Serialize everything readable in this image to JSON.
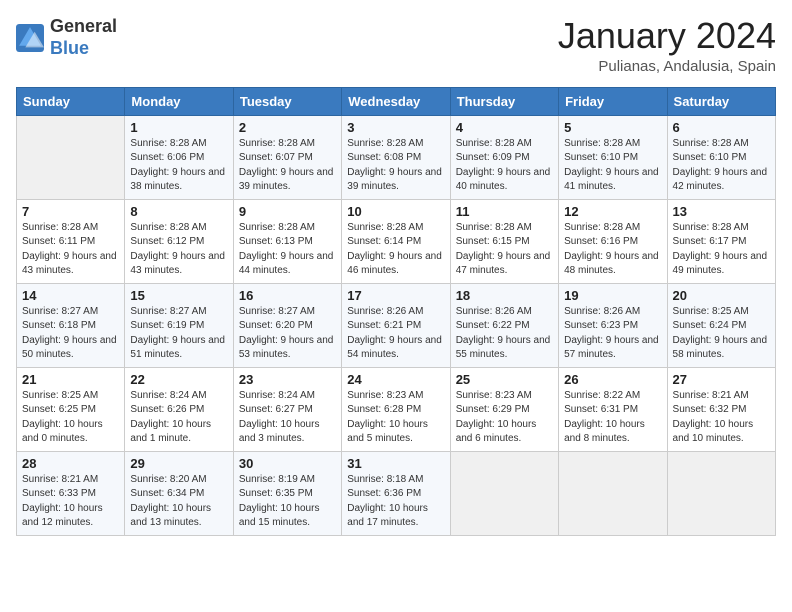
{
  "logo": {
    "line1": "General",
    "line2": "Blue"
  },
  "title": "January 2024",
  "location": "Pulianas, Andalusia, Spain",
  "days_of_week": [
    "Sunday",
    "Monday",
    "Tuesday",
    "Wednesday",
    "Thursday",
    "Friday",
    "Saturday"
  ],
  "weeks": [
    [
      {
        "day": "",
        "sunrise": "",
        "sunset": "",
        "daylight": ""
      },
      {
        "day": "1",
        "sunrise": "Sunrise: 8:28 AM",
        "sunset": "Sunset: 6:06 PM",
        "daylight": "Daylight: 9 hours and 38 minutes."
      },
      {
        "day": "2",
        "sunrise": "Sunrise: 8:28 AM",
        "sunset": "Sunset: 6:07 PM",
        "daylight": "Daylight: 9 hours and 39 minutes."
      },
      {
        "day": "3",
        "sunrise": "Sunrise: 8:28 AM",
        "sunset": "Sunset: 6:08 PM",
        "daylight": "Daylight: 9 hours and 39 minutes."
      },
      {
        "day": "4",
        "sunrise": "Sunrise: 8:28 AM",
        "sunset": "Sunset: 6:09 PM",
        "daylight": "Daylight: 9 hours and 40 minutes."
      },
      {
        "day": "5",
        "sunrise": "Sunrise: 8:28 AM",
        "sunset": "Sunset: 6:10 PM",
        "daylight": "Daylight: 9 hours and 41 minutes."
      },
      {
        "day": "6",
        "sunrise": "Sunrise: 8:28 AM",
        "sunset": "Sunset: 6:10 PM",
        "daylight": "Daylight: 9 hours and 42 minutes."
      }
    ],
    [
      {
        "day": "7",
        "sunrise": "Sunrise: 8:28 AM",
        "sunset": "Sunset: 6:11 PM",
        "daylight": "Daylight: 9 hours and 43 minutes."
      },
      {
        "day": "8",
        "sunrise": "Sunrise: 8:28 AM",
        "sunset": "Sunset: 6:12 PM",
        "daylight": "Daylight: 9 hours and 43 minutes."
      },
      {
        "day": "9",
        "sunrise": "Sunrise: 8:28 AM",
        "sunset": "Sunset: 6:13 PM",
        "daylight": "Daylight: 9 hours and 44 minutes."
      },
      {
        "day": "10",
        "sunrise": "Sunrise: 8:28 AM",
        "sunset": "Sunset: 6:14 PM",
        "daylight": "Daylight: 9 hours and 46 minutes."
      },
      {
        "day": "11",
        "sunrise": "Sunrise: 8:28 AM",
        "sunset": "Sunset: 6:15 PM",
        "daylight": "Daylight: 9 hours and 47 minutes."
      },
      {
        "day": "12",
        "sunrise": "Sunrise: 8:28 AM",
        "sunset": "Sunset: 6:16 PM",
        "daylight": "Daylight: 9 hours and 48 minutes."
      },
      {
        "day": "13",
        "sunrise": "Sunrise: 8:28 AM",
        "sunset": "Sunset: 6:17 PM",
        "daylight": "Daylight: 9 hours and 49 minutes."
      }
    ],
    [
      {
        "day": "14",
        "sunrise": "Sunrise: 8:27 AM",
        "sunset": "Sunset: 6:18 PM",
        "daylight": "Daylight: 9 hours and 50 minutes."
      },
      {
        "day": "15",
        "sunrise": "Sunrise: 8:27 AM",
        "sunset": "Sunset: 6:19 PM",
        "daylight": "Daylight: 9 hours and 51 minutes."
      },
      {
        "day": "16",
        "sunrise": "Sunrise: 8:27 AM",
        "sunset": "Sunset: 6:20 PM",
        "daylight": "Daylight: 9 hours and 53 minutes."
      },
      {
        "day": "17",
        "sunrise": "Sunrise: 8:26 AM",
        "sunset": "Sunset: 6:21 PM",
        "daylight": "Daylight: 9 hours and 54 minutes."
      },
      {
        "day": "18",
        "sunrise": "Sunrise: 8:26 AM",
        "sunset": "Sunset: 6:22 PM",
        "daylight": "Daylight: 9 hours and 55 minutes."
      },
      {
        "day": "19",
        "sunrise": "Sunrise: 8:26 AM",
        "sunset": "Sunset: 6:23 PM",
        "daylight": "Daylight: 9 hours and 57 minutes."
      },
      {
        "day": "20",
        "sunrise": "Sunrise: 8:25 AM",
        "sunset": "Sunset: 6:24 PM",
        "daylight": "Daylight: 9 hours and 58 minutes."
      }
    ],
    [
      {
        "day": "21",
        "sunrise": "Sunrise: 8:25 AM",
        "sunset": "Sunset: 6:25 PM",
        "daylight": "Daylight: 10 hours and 0 minutes."
      },
      {
        "day": "22",
        "sunrise": "Sunrise: 8:24 AM",
        "sunset": "Sunset: 6:26 PM",
        "daylight": "Daylight: 10 hours and 1 minute."
      },
      {
        "day": "23",
        "sunrise": "Sunrise: 8:24 AM",
        "sunset": "Sunset: 6:27 PM",
        "daylight": "Daylight: 10 hours and 3 minutes."
      },
      {
        "day": "24",
        "sunrise": "Sunrise: 8:23 AM",
        "sunset": "Sunset: 6:28 PM",
        "daylight": "Daylight: 10 hours and 5 minutes."
      },
      {
        "day": "25",
        "sunrise": "Sunrise: 8:23 AM",
        "sunset": "Sunset: 6:29 PM",
        "daylight": "Daylight: 10 hours and 6 minutes."
      },
      {
        "day": "26",
        "sunrise": "Sunrise: 8:22 AM",
        "sunset": "Sunset: 6:31 PM",
        "daylight": "Daylight: 10 hours and 8 minutes."
      },
      {
        "day": "27",
        "sunrise": "Sunrise: 8:21 AM",
        "sunset": "Sunset: 6:32 PM",
        "daylight": "Daylight: 10 hours and 10 minutes."
      }
    ],
    [
      {
        "day": "28",
        "sunrise": "Sunrise: 8:21 AM",
        "sunset": "Sunset: 6:33 PM",
        "daylight": "Daylight: 10 hours and 12 minutes."
      },
      {
        "day": "29",
        "sunrise": "Sunrise: 8:20 AM",
        "sunset": "Sunset: 6:34 PM",
        "daylight": "Daylight: 10 hours and 13 minutes."
      },
      {
        "day": "30",
        "sunrise": "Sunrise: 8:19 AM",
        "sunset": "Sunset: 6:35 PM",
        "daylight": "Daylight: 10 hours and 15 minutes."
      },
      {
        "day": "31",
        "sunrise": "Sunrise: 8:18 AM",
        "sunset": "Sunset: 6:36 PM",
        "daylight": "Daylight: 10 hours and 17 minutes."
      },
      {
        "day": "",
        "sunrise": "",
        "sunset": "",
        "daylight": ""
      },
      {
        "day": "",
        "sunrise": "",
        "sunset": "",
        "daylight": ""
      },
      {
        "day": "",
        "sunrise": "",
        "sunset": "",
        "daylight": ""
      }
    ]
  ]
}
